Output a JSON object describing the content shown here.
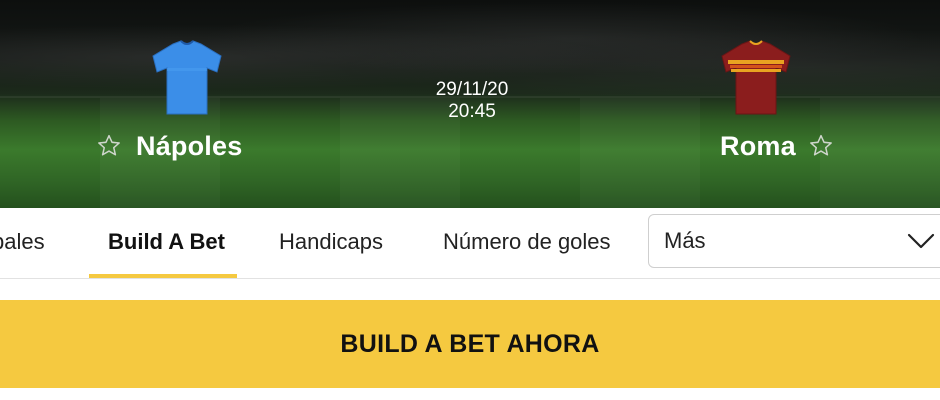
{
  "match": {
    "home_team": "Nápoles",
    "away_team": "Roma",
    "date": "29/11/20",
    "time": "20:45",
    "home_jersey_color": "#3b8ee8",
    "away_jersey_color": "#8b1d1d",
    "away_jersey_band": "#e9a321"
  },
  "tabs": {
    "items": [
      {
        "label": "pales"
      },
      {
        "label": "Build A Bet"
      },
      {
        "label": "Handicaps"
      },
      {
        "label": "Número de goles"
      }
    ],
    "active_index": 1,
    "more_label": "Más"
  },
  "cta": {
    "label": "BUILD A BET AHORA",
    "color": "#f5c940"
  },
  "icons": {
    "favorite": "star-outline-icon",
    "dropdown": "chevron-down-icon"
  }
}
